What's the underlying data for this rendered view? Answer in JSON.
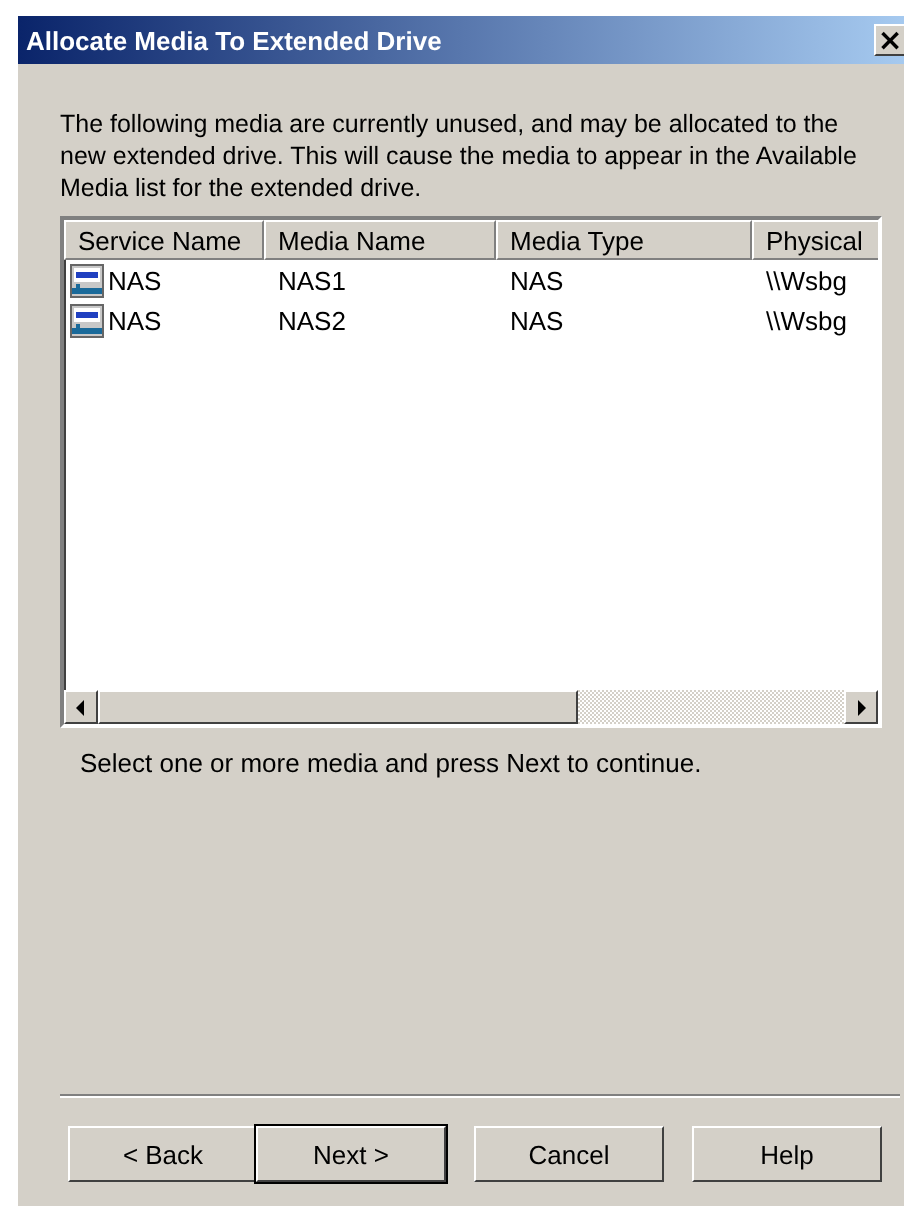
{
  "window": {
    "title": "Allocate Media To Extended Drive",
    "close": "×"
  },
  "intro": "The following media are currently unused, and may be allocated to the new extended drive.  This will cause the media to appear in the Available Media list for the extended drive.",
  "table": {
    "columns": [
      "Service Name",
      "Media Name",
      "Media Type",
      "Physical"
    ],
    "rows": [
      {
        "cells": [
          "NAS",
          "NAS1",
          "NAS",
          "\\\\Wsbg"
        ]
      },
      {
        "cells": [
          "NAS",
          "NAS2",
          "NAS",
          "\\\\Wsbg"
        ]
      }
    ]
  },
  "hint": "Select one or more media and press Next to continue.",
  "buttons": [
    {
      "label": "< Back",
      "default": false
    },
    {
      "label": "Next >",
      "default": true
    },
    {
      "label": "Cancel",
      "default": false
    },
    {
      "label": "Help",
      "default": false
    }
  ]
}
